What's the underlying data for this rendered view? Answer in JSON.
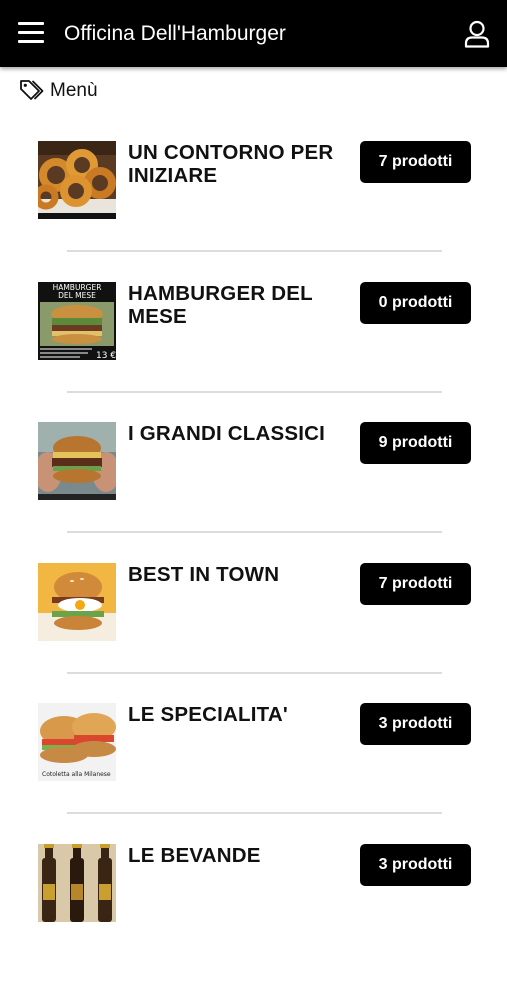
{
  "header": {
    "title": "Officina Dell'Hamburger",
    "menu_icon": "hamburger-menu-icon",
    "user_icon": "user-icon"
  },
  "breadcrumb": {
    "icon": "tag-icon",
    "label": "Menù"
  },
  "categories": [
    {
      "name": "UN CONTORNO PER INIZIARE",
      "count_label": "7 prodotti",
      "image": "onion-rings"
    },
    {
      "name": "HAMBURGER DEL MESE",
      "count_label": "0 prodotti",
      "image": "burger-of-month-poster",
      "image_text": {
        "title_line1": "HAMBURGER",
        "title_line2": "DEL MESE",
        "price": "13 €"
      }
    },
    {
      "name": "I GRANDI CLASSICI",
      "count_label": "9 prodotti",
      "image": "hand-held-burger"
    },
    {
      "name": "BEST IN TOWN",
      "count_label": "7 prodotti",
      "image": "egg-burger"
    },
    {
      "name": "LE SPECIALITA'",
      "count_label": "3 prodotti",
      "image": "cutlet-sandwich",
      "image_text": {
        "caption": "Cotoletta alla Milanese"
      }
    },
    {
      "name": "LE BEVANDE",
      "count_label": "3 prodotti",
      "image": "beer-bottles"
    }
  ],
  "colors": {
    "header_bg": "#000000",
    "badge_bg": "#000000",
    "badge_text": "#ffffff",
    "divider": "#dcdcdc"
  }
}
